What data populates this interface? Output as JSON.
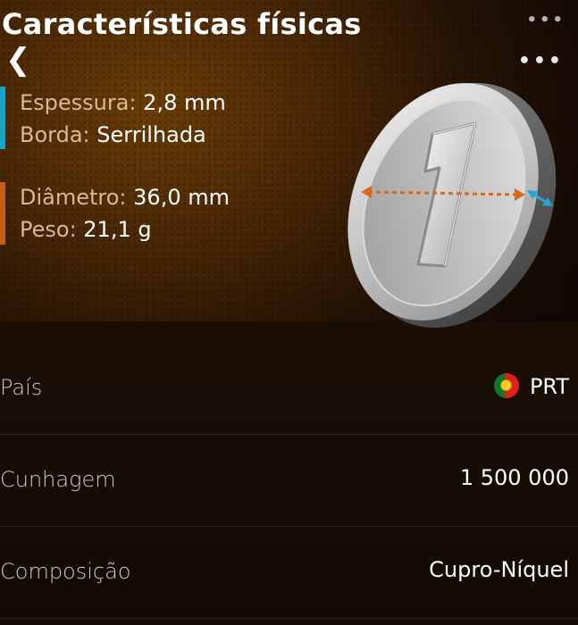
{
  "header": {
    "title": "Características físicas",
    "menu_top": "•••",
    "menu_main": "•••",
    "back": "❮"
  },
  "specs": {
    "group1": [
      {
        "label": "Espessura:",
        "value": " 2,8 mm"
      },
      {
        "label": "Borda:",
        "value": " Serrilhada"
      }
    ],
    "group2": [
      {
        "label": "Diâmetro:",
        "value": " 36,0 mm"
      },
      {
        "label": "Peso:",
        "value": " 21,1 g"
      }
    ],
    "colors": {
      "group1_bar": "#1aa3c8",
      "group2_bar": "#c2601a",
      "diameter_arrow": "#d46a1e",
      "thickness_arrow": "#23a8d6"
    }
  },
  "details": [
    {
      "label": "País",
      "value": "PRT",
      "flag": "portugal-flag"
    },
    {
      "label": "Cunhagem",
      "value": "1 500 000"
    },
    {
      "label": "Composição",
      "value": "Cupro-Níquel"
    }
  ]
}
